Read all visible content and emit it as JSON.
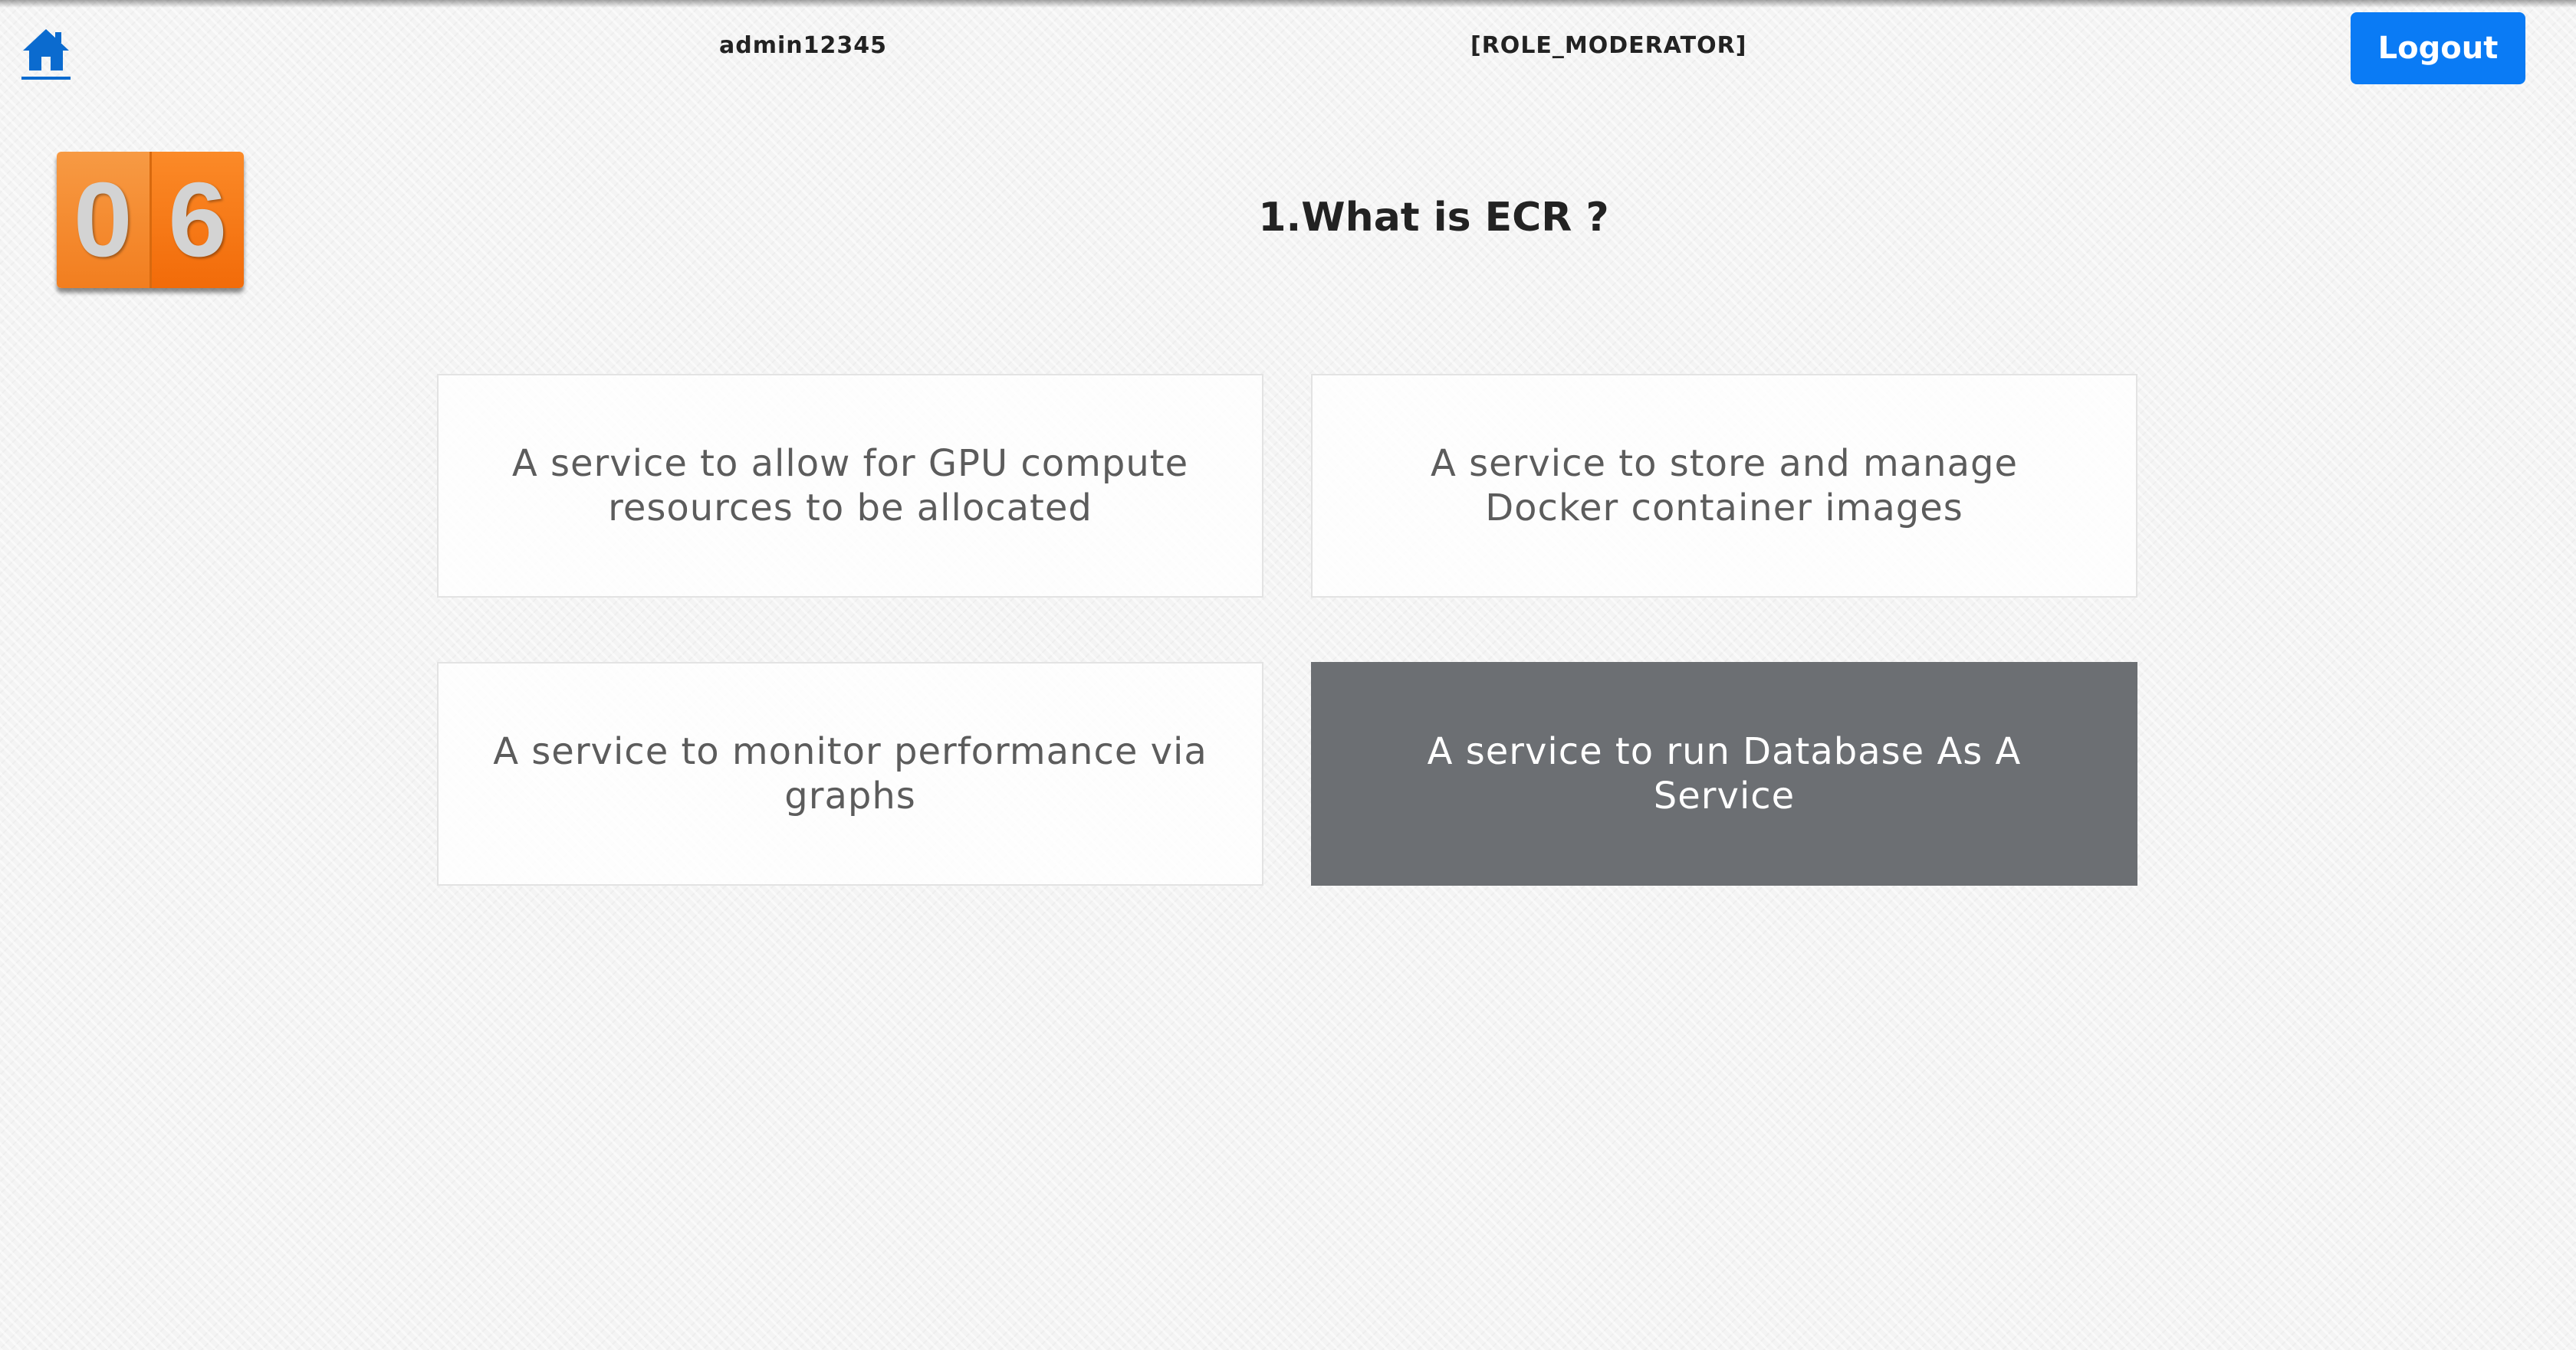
{
  "header": {
    "home_icon": "home-icon",
    "username": "admin12345",
    "role": "[ROLE_MODERATOR]",
    "logout_label": "Logout",
    "accent_color": "#0a7bf5"
  },
  "timer": {
    "digits": [
      "0",
      "6"
    ],
    "color": "#f47b1c"
  },
  "question": {
    "text": "1.What is ECR ?",
    "options": [
      {
        "text": "A service to allow for GPU compute resources to be allocated",
        "selected": false
      },
      {
        "text": "A service to store and manage Docker container images",
        "selected": false
      },
      {
        "text": "A service to monitor performance via graphs",
        "selected": false
      },
      {
        "text": "A service to run Database As A Service",
        "selected": true
      }
    ],
    "selected_color": "#6c6f73"
  }
}
